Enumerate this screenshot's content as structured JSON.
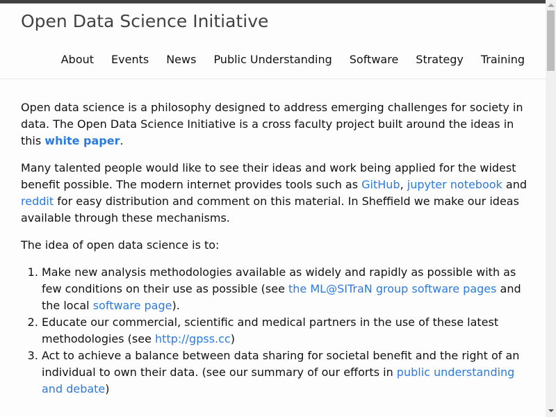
{
  "header": {
    "site_title": "Open Data Science Initiative",
    "nav": [
      {
        "label": "About"
      },
      {
        "label": "Events"
      },
      {
        "label": "News"
      },
      {
        "label": "Public Understanding"
      },
      {
        "label": "Software"
      },
      {
        "label": "Strategy"
      },
      {
        "label": "Training"
      }
    ]
  },
  "content": {
    "p1": {
      "text_a": "Open data science is a philosophy designed to address emerging challenges for society in data. The Open Data Science Initiative is a cross faculty project built around the ideas in this ",
      "link": "white paper",
      "text_b": "."
    },
    "p2": {
      "text_a": "Many talented people would like to see their ideas and work being applied for the widest benefit possible. The modern internet provides tools such as ",
      "link1": "GitHub",
      "sep": ", ",
      "link2": "jupyter notebook",
      "text_b": " and ",
      "link3": "reddit",
      "text_c": " for easy distribution and comment on this material. In Sheffield we make our ideas available through these mechanisms."
    },
    "p3": "The idea of open data science is to:",
    "list": [
      {
        "text_a": "Make new analysis methodologies available as widely and rapidly as possible with as few conditions on their use as possible (see ",
        "link1": "the ML@SITraN group software pages",
        "text_b": " and the local ",
        "link2": "software page",
        "text_c": ")."
      },
      {
        "text_a": "Educate our commercial, scientific and medical partners in the use of these latest methodologies (see ",
        "link1": "http://gpss.cc",
        "text_b": ")"
      },
      {
        "text_a": "Act to achieve a balance between data sharing for societal benefit and the right of an individual to own their data. (see our summary of our efforts in ",
        "link1": "public understanding and debate",
        "text_b": ")"
      }
    ]
  },
  "colors": {
    "link": "#2a7ae2",
    "title": "#424242",
    "topbar": "#424242"
  }
}
